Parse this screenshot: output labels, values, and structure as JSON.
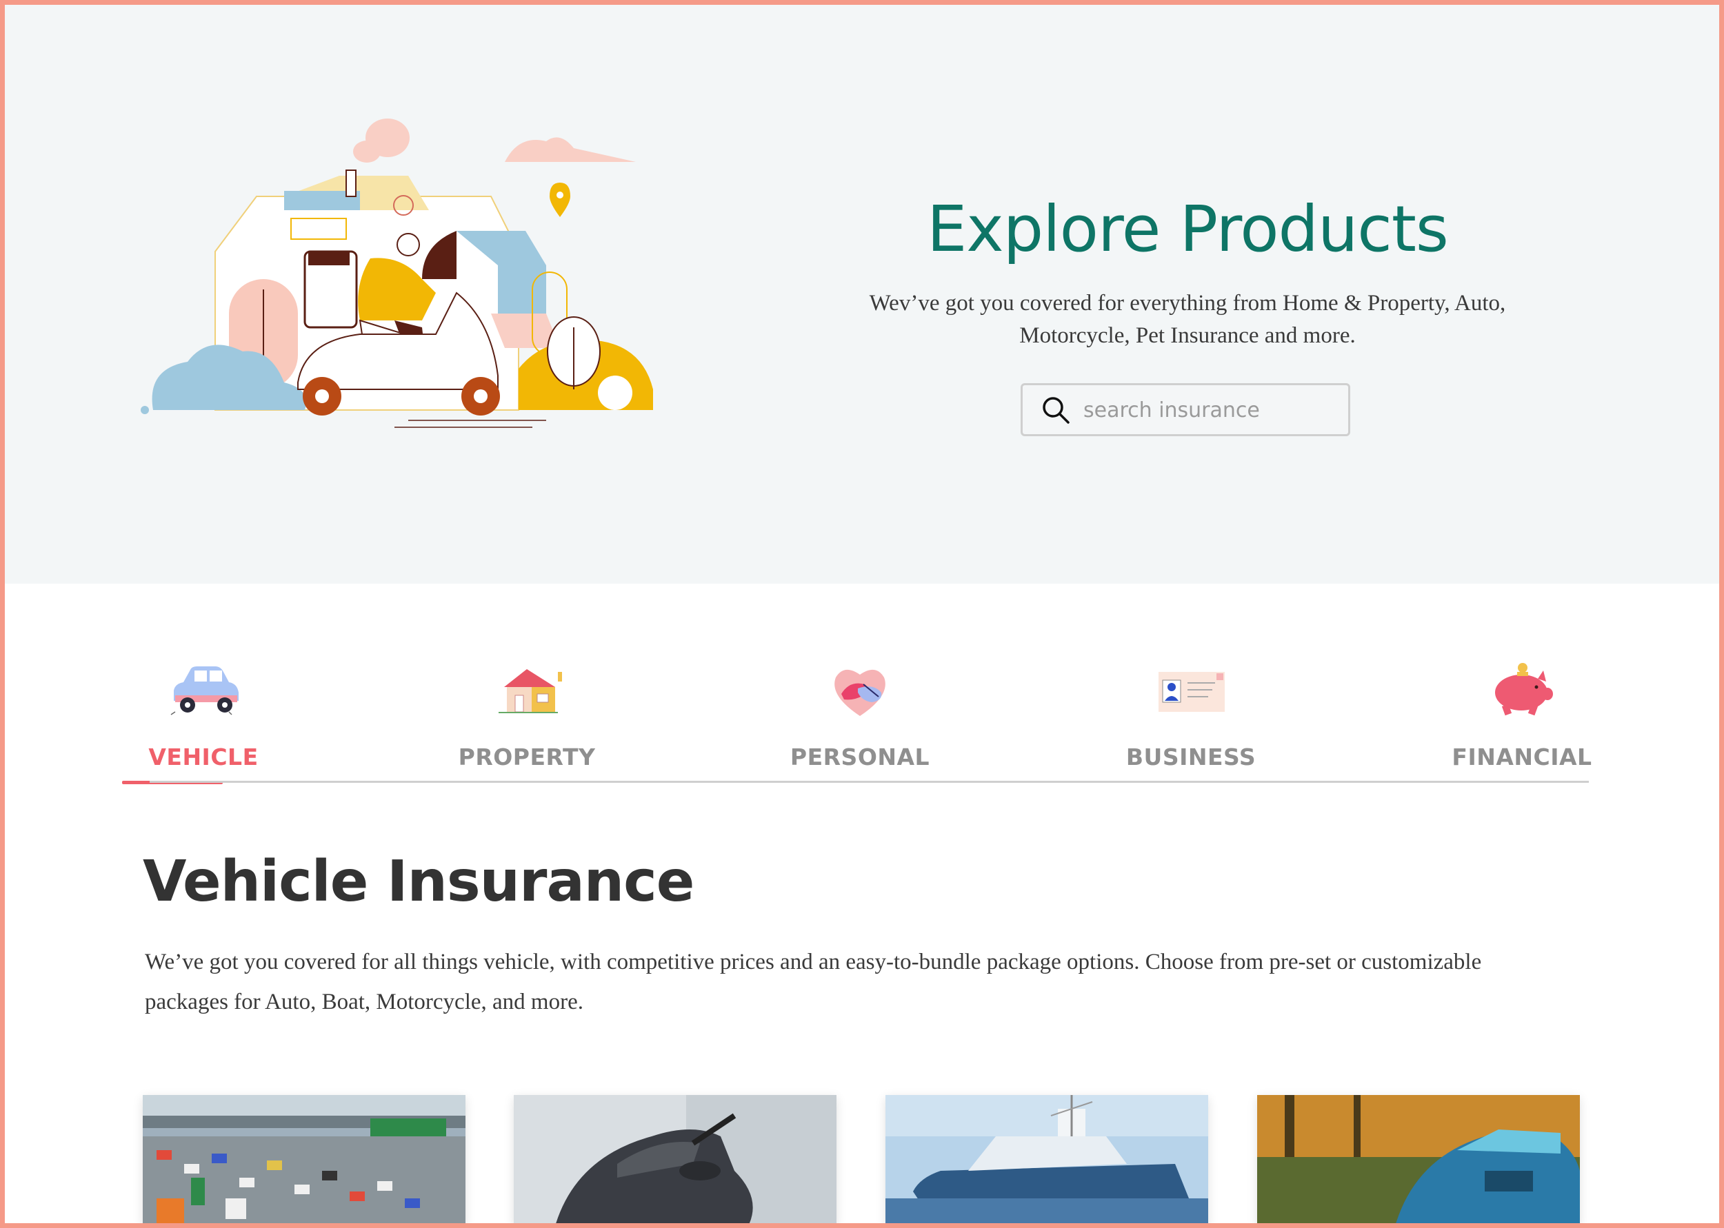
{
  "hero": {
    "title": "Explore Products",
    "subtitle_line1": "Wev’ve got you covered for everything from Home & Property, Auto,",
    "subtitle_line2": "Motorcycle, Pet Insurance and more.",
    "search": {
      "placeholder": "search insurance",
      "value": "",
      "icon": "search-icon"
    }
  },
  "tabs": [
    {
      "label": "VEHICLE",
      "icon": "car-icon",
      "active": true
    },
    {
      "label": "PROPERTY",
      "icon": "house-icon",
      "active": false
    },
    {
      "label": "PERSONAL",
      "icon": "heart-hand-icon",
      "active": false
    },
    {
      "label": "BUSINESS",
      "icon": "id-card-icon",
      "active": false
    },
    {
      "label": "FINANCIAL",
      "icon": "piggy-bank-icon",
      "active": false
    }
  ],
  "section": {
    "title": "Vehicle Insurance",
    "body_line1": "We’ve got you covered for all things vehicle, with competitive prices and an easy-to-bundle package options. Choose from pre-set or customizable",
    "body_line2": "packages for Auto, Boat, Motorcycle, and more."
  },
  "cards": [
    {
      "image": "highway-traffic-photo"
    },
    {
      "image": "motorcycle-photo"
    },
    {
      "image": "boat-photo"
    },
    {
      "image": "vintage-car-photo"
    }
  ],
  "colors": {
    "accent": "#f0606a",
    "brand_teal": "#0e7566",
    "hero_bg": "#f3f6f7",
    "border_frame": "#f59a88"
  }
}
